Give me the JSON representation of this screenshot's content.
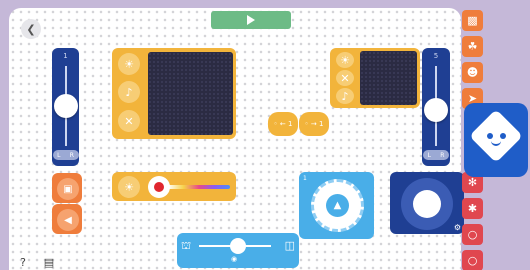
{
  "toolbar": {
    "back_icon": "chevron-left-icon",
    "play_icon": "play-icon"
  },
  "left_slider": {
    "value_label": "1",
    "left": "L",
    "right": "R",
    "level": 0.5
  },
  "right_slider": {
    "value_label": "5",
    "left": "L",
    "right": "R",
    "level": 0.55
  },
  "matrix_left": {
    "buttons": [
      "sun-icon",
      "music-note-icon",
      "x-icon"
    ]
  },
  "matrix_right": {
    "buttons": [
      "sun-icon",
      "x-icon",
      "music-note-icon"
    ]
  },
  "output_blocks": [
    {
      "icon": "car-icon"
    },
    {
      "icon": "horn-icon"
    }
  ],
  "value_pills": [
    {
      "label": "◦ ← 1"
    },
    {
      "label": "◦ → 1"
    }
  ],
  "color_slider": {
    "icon": "sun-icon",
    "color": "#e0262e"
  },
  "dial": {
    "label": "1",
    "icon": "rocket-icon"
  },
  "joystick": {
    "icon": "gear-icon"
  },
  "bottom_bar": {
    "icon_left": "bell-icon",
    "icon_right": "headphones-icon",
    "icon_bottom": "wifi-icon"
  },
  "right_sidebar": [
    "robot-icon",
    "rabbit-icon",
    "chicken-icon",
    "run-icon",
    "crab-icon",
    "jumping-person-icon",
    "lightbulb-icon",
    "lightbulb-icon"
  ],
  "help_label": "?",
  "bottom_left_icon": "chart-icon",
  "colors": {
    "accent_blue": "#1f3f93",
    "accent_yellow": "#f2b43b",
    "accent_orange": "#ef7d3c",
    "accent_red": "#e0474f",
    "accent_light_blue": "#49aee8",
    "play_green": "#6dbb86",
    "background": "#c5b8d8"
  }
}
